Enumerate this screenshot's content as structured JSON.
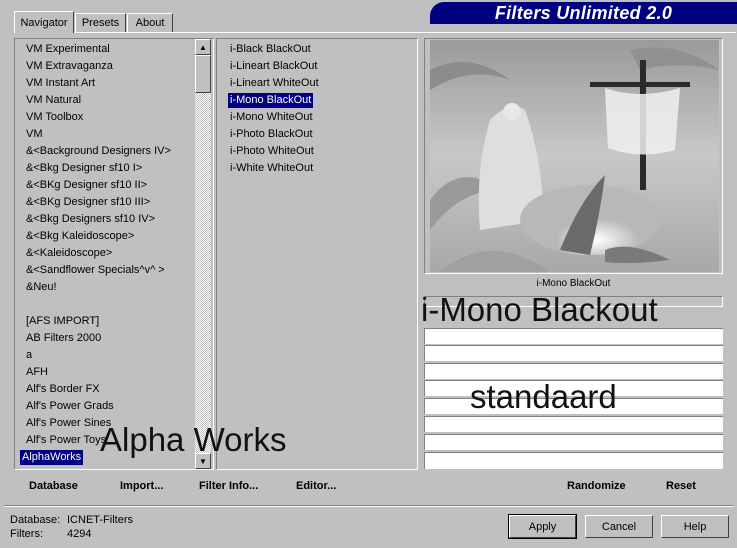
{
  "window": {
    "title": "Filters Unlimited 2.0"
  },
  "tabs": [
    {
      "label": "Navigator",
      "active": true
    },
    {
      "label": "Presets",
      "active": false
    },
    {
      "label": "About",
      "active": false
    }
  ],
  "categories": [
    "VM Experimental",
    "VM Extravaganza",
    "VM Instant Art",
    "VM Natural",
    "VM Toolbox",
    "VM",
    "&<Background Designers IV>",
    "&<Bkg Designer sf10 I>",
    "&<BKg Designer sf10 II>",
    "&<BKg Designer sf10 III>",
    "&<Bkg Designers sf10 IV>",
    "&<Bkg Kaleidoscope>",
    "&<Kaleidoscope>",
    "&<Sandflower Specials^v^ >",
    "&Neu!",
    "",
    "[AFS IMPORT]",
    "AB Filters 2000",
    "a",
    "AFH",
    "Alf's Border FX",
    "Alf's Power Grads",
    "Alf's Power Sines",
    "Alf's Power Toys",
    "AlphaWorks"
  ],
  "selected_category": "AlphaWorks",
  "filters": [
    "i-Black BlackOut",
    "i-Lineart BlackOut",
    "i-Lineart WhiteOut",
    "i-Mono BlackOut",
    "i-Mono WhiteOut",
    "i-Photo BlackOut",
    "i-Photo WhiteOut",
    "i-White WhiteOut"
  ],
  "selected_filter": "i-Mono BlackOut",
  "preview": {
    "caption": "i-Mono BlackOut"
  },
  "overlays": {
    "filter_name": "i-Mono Blackout",
    "preset": "standaard",
    "category": "Alpha Works"
  },
  "actions": {
    "database": "Database",
    "import": "Import...",
    "filter_info": "Filter Info...",
    "editor": "Editor...",
    "randomize": "Randomize",
    "reset": "Reset"
  },
  "status": {
    "database_label": "Database:",
    "database_value": "ICNET-Filters",
    "filters_label": "Filters:",
    "filters_value": "4294"
  },
  "buttons": {
    "apply": "Apply",
    "cancel": "Cancel",
    "help": "Help"
  }
}
